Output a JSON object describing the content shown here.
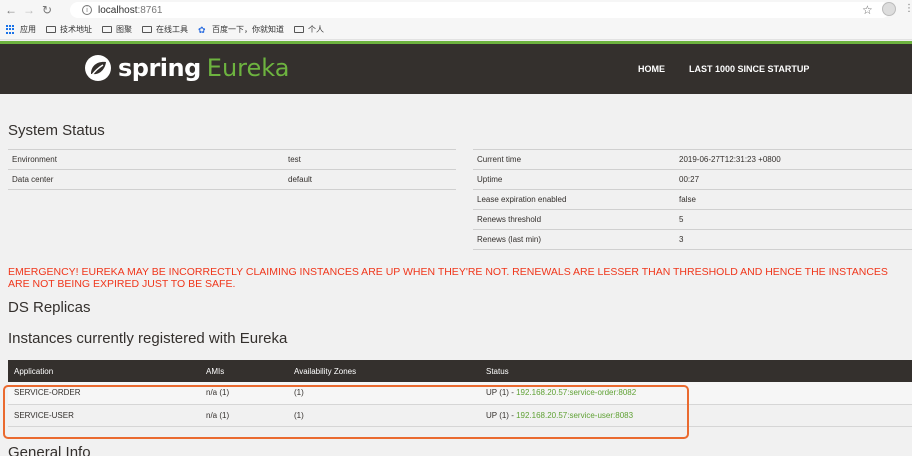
{
  "browser": {
    "url_host": "localhost",
    "url_port": ":8761",
    "bookmarks": [
      "应用",
      "技术地址",
      "图聚",
      "在线工具",
      "百度一下，你就知道",
      "个人"
    ]
  },
  "navbar": {
    "brand_spring": "spring",
    "brand_eureka": "Eureka",
    "links": [
      "HOME",
      "LAST 1000 SINCE STARTUP"
    ]
  },
  "system_status": {
    "title": "System Status",
    "left": [
      {
        "label": "Environment",
        "value": "test"
      },
      {
        "label": "Data center",
        "value": "default"
      }
    ],
    "right": [
      {
        "label": "Current time",
        "value": "2019-06-27T12:31:23 +0800"
      },
      {
        "label": "Uptime",
        "value": "00:27"
      },
      {
        "label": "Lease expiration enabled",
        "value": "false"
      },
      {
        "label": "Renews threshold",
        "value": "5"
      },
      {
        "label": "Renews (last min)",
        "value": "3"
      }
    ]
  },
  "emergency": "EMERGENCY! EUREKA MAY BE INCORRECTLY CLAIMING INSTANCES ARE UP WHEN THEY'RE NOT. RENEWALS ARE LESSER THAN THRESHOLD AND HENCE THE INSTANCES ARE NOT BEING EXPIRED JUST TO BE SAFE.",
  "ds_replicas_title": "DS Replicas",
  "instances": {
    "title": "Instances currently registered with Eureka",
    "headers": [
      "Application",
      "AMIs",
      "Availability Zones",
      "Status"
    ],
    "rows": [
      {
        "app": "SERVICE-ORDER",
        "amis": "n/a (1)",
        "zones": "(1)",
        "status": "UP (1) - ",
        "link": "192.168.20.57:service-order:8082"
      },
      {
        "app": "SERVICE-USER",
        "amis": "n/a (1)",
        "zones": "(1)",
        "status": "UP (1) - ",
        "link": "192.168.20.57:service-user:8083"
      }
    ]
  },
  "general_info_title": "General Info",
  "colors": {
    "brand_green": "#6db33f",
    "nav_bg": "#34302d",
    "emergency": "#f0361b",
    "highlight": "#ea6a2f"
  }
}
